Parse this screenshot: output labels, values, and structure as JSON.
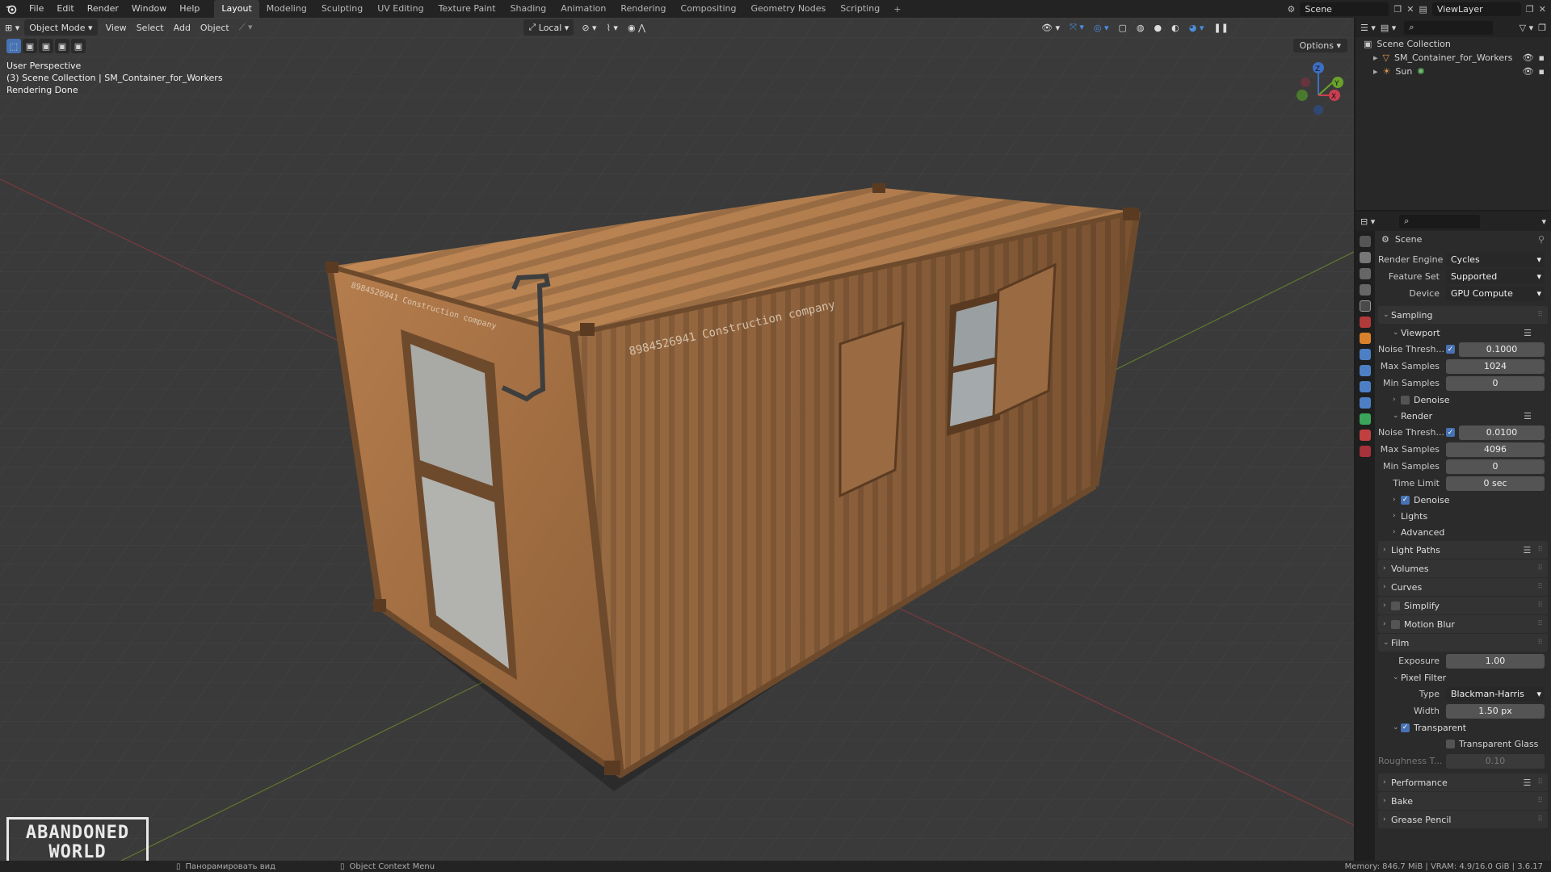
{
  "topbar": {
    "menus": [
      "File",
      "Edit",
      "Render",
      "Window",
      "Help"
    ],
    "workspaces": [
      "Layout",
      "Modeling",
      "Sculpting",
      "UV Editing",
      "Texture Paint",
      "Shading",
      "Animation",
      "Rendering",
      "Compositing",
      "Geometry Nodes",
      "Scripting"
    ],
    "active_workspace": "Layout",
    "add_tab": "+",
    "scene": "Scene",
    "view_layer": "ViewLayer"
  },
  "viewport": {
    "mode": "Object Mode",
    "menus": [
      "View",
      "Select",
      "Add",
      "Object"
    ],
    "orientation": "Local",
    "options": "Options",
    "overlay_lines": [
      "User Perspective",
      "(3) Scene Collection | SM_Container_for_Workers",
      "Rendering Done"
    ],
    "container_text_side": "8984526941  Construction company",
    "container_text_front": "8984526941  Construction company",
    "gizmo": {
      "z": "Z",
      "y": "Y",
      "x": "X"
    },
    "watermark": [
      "ABANDONED",
      "WORLD"
    ]
  },
  "outliner": {
    "root": "Scene Collection",
    "items": [
      {
        "name": "SM_Container_for_Workers"
      },
      {
        "name": "Sun"
      }
    ]
  },
  "properties": {
    "context": "Scene",
    "render_engine": {
      "label": "Render Engine",
      "value": "Cycles"
    },
    "feature_set": {
      "label": "Feature Set",
      "value": "Supported"
    },
    "device": {
      "label": "Device",
      "value": "GPU Compute"
    },
    "sampling": {
      "title": "Sampling",
      "viewport": {
        "title": "Viewport",
        "noise_label": "Noise Thresh...",
        "noise_value": "0.1000",
        "max_label": "Max Samples",
        "max_value": "1024",
        "min_label": "Min Samples",
        "min_value": "0",
        "denoise": "Denoise"
      },
      "render": {
        "title": "Render",
        "noise_label": "Noise Thresh...",
        "noise_value": "0.0100",
        "max_label": "Max Samples",
        "max_value": "4096",
        "min_label": "Min Samples",
        "min_value": "0",
        "time_label": "Time Limit",
        "time_value": "0 sec",
        "denoise": "Denoise"
      },
      "lights": "Lights",
      "advanced": "Advanced"
    },
    "sections": {
      "light_paths": "Light Paths",
      "volumes": "Volumes",
      "curves": "Curves",
      "simplify": "Simplify",
      "motion_blur": "Motion Blur",
      "film": "Film",
      "performance": "Performance",
      "bake": "Bake",
      "grease_pencil": "Grease Pencil"
    },
    "film": {
      "exposure_label": "Exposure",
      "exposure_value": "1.00",
      "pixel_filter": "Pixel Filter",
      "type_label": "Type",
      "type_value": "Blackman-Harris",
      "width_label": "Width",
      "width_value": "1.50 px",
      "transparent": "Transparent",
      "transparent_glass": "Transparent Glass",
      "roughness_label": "Roughness T...",
      "roughness_value": "0.10"
    }
  },
  "statusbar": {
    "hint1": "Панорамировать вид",
    "hint2": "Object Context Menu",
    "stats": "Memory: 846.7 MiB | VRAM: 4.9/16.0 GiB | 3.6.17"
  }
}
